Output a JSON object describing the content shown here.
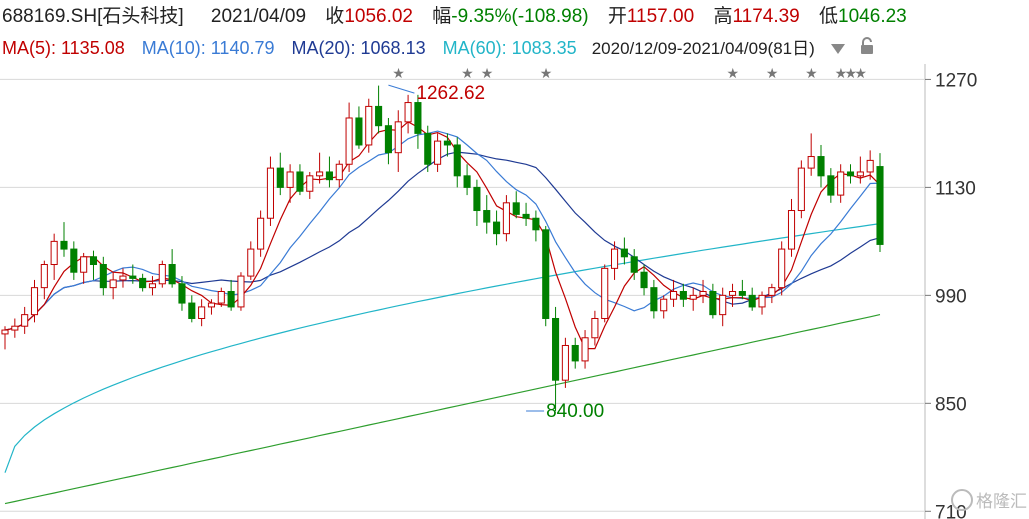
{
  "header": {
    "symbol": "688169.SH[石头科技]",
    "date": "2021/04/09",
    "close_label": "收",
    "close": "1056.02",
    "change_label": "幅",
    "change": "-9.35%(-108.98)",
    "open_label": "开",
    "open": "1157.00",
    "high_label": "高",
    "high": "1174.39",
    "low_label": "低",
    "low": "1046.23"
  },
  "ma": {
    "ma5": "MA(5): 1135.08",
    "ma10": "MA(10): 1140.79",
    "ma20": "MA(20): 1068.13",
    "ma60": "MA(60): 1083.35",
    "range": "2020/12/09-2021/04/09(81日)"
  },
  "colors": {
    "up": "#c00000",
    "down": "#008000",
    "ma5": "#c00000",
    "ma10": "#3a7bd5",
    "ma20": "#1f3a93",
    "ma60": "#22b5c8",
    "ma250": "#2e9e2e",
    "grid": "#d8d8d8"
  },
  "icons": [
    "chevron-down-icon",
    "lock-icon"
  ],
  "chart_data": {
    "type": "candlestick",
    "ylim": [
      700,
      1290
    ],
    "y_ticks": [
      710,
      850,
      990,
      1130,
      1270
    ],
    "annotations": [
      {
        "label": "1262.62",
        "value": 1262.62,
        "index": 39
      },
      {
        "label": "840.00",
        "value": 840.0,
        "index": 53
      }
    ],
    "event_star_indices": [
      40,
      47,
      49,
      55,
      74,
      78,
      82,
      85,
      86,
      87
    ],
    "watermark": "格隆汇",
    "candles": [
      [
        940,
        950,
        920,
        945
      ],
      [
        945,
        960,
        935,
        950
      ],
      [
        950,
        975,
        940,
        965
      ],
      [
        965,
        1010,
        955,
        1000
      ],
      [
        1000,
        1035,
        985,
        1030
      ],
      [
        1030,
        1070,
        1010,
        1060
      ],
      [
        1060,
        1085,
        1040,
        1050
      ],
      [
        1050,
        1060,
        1010,
        1020
      ],
      [
        1020,
        1045,
        1005,
        1040
      ],
      [
        1040,
        1048,
        1010,
        1030
      ],
      [
        1030,
        1040,
        990,
        1000
      ],
      [
        1000,
        1020,
        985,
        1010
      ],
      [
        1010,
        1025,
        1000,
        1015
      ],
      [
        1015,
        1030,
        1005,
        1012
      ],
      [
        1012,
        1018,
        995,
        1000
      ],
      [
        1000,
        1015,
        990,
        1005
      ],
      [
        1005,
        1035,
        1000,
        1030
      ],
      [
        1030,
        1050,
        1000,
        1005
      ],
      [
        1005,
        1015,
        970,
        980
      ],
      [
        980,
        990,
        955,
        960
      ],
      [
        960,
        985,
        950,
        975
      ],
      [
        975,
        985,
        965,
        980
      ],
      [
        980,
        1000,
        975,
        995
      ],
      [
        995,
        1010,
        970,
        975
      ],
      [
        975,
        1020,
        970,
        1015
      ],
      [
        1015,
        1060,
        1010,
        1050
      ],
      [
        1050,
        1100,
        1040,
        1090
      ],
      [
        1090,
        1170,
        1080,
        1155
      ],
      [
        1155,
        1175,
        1120,
        1130
      ],
      [
        1130,
        1160,
        1110,
        1150
      ],
      [
        1150,
        1160,
        1120,
        1125
      ],
      [
        1125,
        1150,
        1115,
        1145
      ],
      [
        1145,
        1175,
        1135,
        1150
      ],
      [
        1150,
        1170,
        1130,
        1140
      ],
      [
        1140,
        1165,
        1130,
        1160
      ],
      [
        1160,
        1240,
        1150,
        1220
      ],
      [
        1220,
        1235,
        1180,
        1185
      ],
      [
        1185,
        1245,
        1175,
        1235
      ],
      [
        1235,
        1262,
        1200,
        1210
      ],
      [
        1210,
        1220,
        1160,
        1175
      ],
      [
        1175,
        1230,
        1150,
        1215
      ],
      [
        1215,
        1250,
        1200,
        1240
      ],
      [
        1240,
        1250,
        1180,
        1200
      ],
      [
        1200,
        1210,
        1150,
        1160
      ],
      [
        1160,
        1200,
        1150,
        1190
      ],
      [
        1190,
        1200,
        1170,
        1185
      ],
      [
        1185,
        1195,
        1130,
        1145
      ],
      [
        1145,
        1160,
        1120,
        1130
      ],
      [
        1130,
        1140,
        1080,
        1100
      ],
      [
        1100,
        1120,
        1070,
        1085
      ],
      [
        1085,
        1100,
        1055,
        1070
      ],
      [
        1070,
        1120,
        1060,
        1110
      ],
      [
        1110,
        1125,
        1090,
        1095
      ],
      [
        1095,
        1110,
        1080,
        1090
      ],
      [
        1090,
        1100,
        1060,
        1075
      ],
      [
        1075,
        1080,
        950,
        960
      ],
      [
        960,
        975,
        840,
        880
      ],
      [
        880,
        935,
        870,
        925
      ],
      [
        925,
        935,
        895,
        905
      ],
      [
        905,
        945,
        895,
        935
      ],
      [
        935,
        970,
        925,
        960
      ],
      [
        960,
        1030,
        955,
        1025
      ],
      [
        1025,
        1060,
        1010,
        1050
      ],
      [
        1050,
        1065,
        1030,
        1040
      ],
      [
        1040,
        1050,
        1010,
        1020
      ],
      [
        1020,
        1030,
        990,
        1000
      ],
      [
        1000,
        1010,
        960,
        970
      ],
      [
        970,
        990,
        960,
        985
      ],
      [
        985,
        1010,
        975,
        995
      ],
      [
        995,
        1005,
        975,
        985
      ],
      [
        985,
        1000,
        970,
        990
      ],
      [
        990,
        1010,
        980,
        995
      ],
      [
        995,
        1005,
        960,
        965
      ],
      [
        965,
        1000,
        950,
        990
      ],
      [
        990,
        1005,
        975,
        995
      ],
      [
        995,
        1010,
        985,
        990
      ],
      [
        990,
        1000,
        970,
        975
      ],
      [
        975,
        995,
        965,
        990
      ],
      [
        990,
        1005,
        980,
        1000
      ],
      [
        1000,
        1060,
        990,
        1050
      ],
      [
        1050,
        1115,
        1040,
        1100
      ],
      [
        1100,
        1165,
        1090,
        1155
      ],
      [
        1155,
        1200,
        1145,
        1170
      ],
      [
        1170,
        1185,
        1130,
        1145
      ],
      [
        1145,
        1155,
        1110,
        1120
      ],
      [
        1120,
        1160,
        1110,
        1150
      ],
      [
        1150,
        1160,
        1135,
        1145
      ],
      [
        1145,
        1170,
        1135,
        1150
      ],
      [
        1150,
        1178,
        1140,
        1165
      ],
      [
        1157,
        1174.39,
        1046.23,
        1056.02
      ]
    ]
  }
}
